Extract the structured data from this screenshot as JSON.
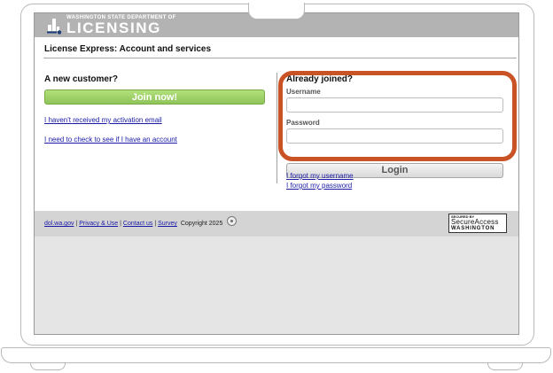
{
  "banner": {
    "agency_line": "WASHINGTON STATE DEPARTMENT OF",
    "agency_name": "LICENSING",
    "logo": "dol-logo"
  },
  "app": {
    "title": "License Express: Account and services"
  },
  "new_customer": {
    "heading": "A new customer?",
    "join_label": "Join now!",
    "link_activation": "I haven't received my activation email",
    "link_check_account": "I need to check to see if I have an account"
  },
  "login": {
    "heading": "Already joined?",
    "username_label": "Username",
    "username_value": "",
    "password_label": "Password",
    "password_value": "",
    "login_label": "Login",
    "forgot_username": "I forgot my username",
    "forgot_password": "I forgot my password"
  },
  "footer": {
    "links": [
      "dol.wa.gov",
      "Privacy & Use",
      "Contact us",
      "Survey"
    ],
    "separator": "|",
    "copyright": "Copyright 2025",
    "icon": "lock-icon",
    "badge_top": "SECURED BY",
    "badge_mid": "SecureAccess",
    "badge_bottom": "WASHINGTON"
  },
  "colors": {
    "highlight": "#c95325",
    "join_green": "#9ccf66",
    "banner_gray": "#b3b3b3",
    "link_blue": "#1a1aa6"
  }
}
